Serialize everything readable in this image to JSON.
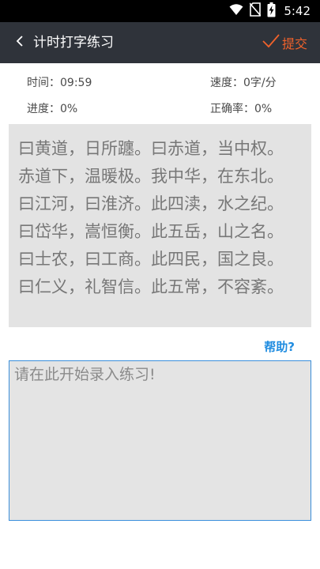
{
  "status_bar": {
    "time": "5:42",
    "icons": [
      "wifi-icon",
      "no-sim-icon",
      "battery-icon"
    ]
  },
  "app_bar": {
    "title": "计时打字练习",
    "submit_label": "提交",
    "back_icon": "chevron-left-icon",
    "submit_icon": "checkmark-icon",
    "colors": {
      "background": "#2f333a",
      "accent": "#f0622b"
    }
  },
  "stats": {
    "time_label": "时间：09:59",
    "speed_label": "速度：0字/分",
    "progress_label": "进度：0%",
    "accuracy_label": "正确率：0%"
  },
  "passage": {
    "lines": [
      "曰黄道，日所躔。曰赤道，当中权。",
      "赤道下，温暖极。我中华，在东北。",
      "曰江河，曰淮济。此四渎，水之纪。",
      "曰岱华，嵩恒衡。此五岳，山之名。",
      "曰士农，曰工商。此四民，国之良。",
      "曰仁义，礼智信。此五常，不容紊。"
    ]
  },
  "help": {
    "label": "帮助?"
  },
  "input": {
    "placeholder": "请在此开始录入练习!",
    "value": ""
  }
}
